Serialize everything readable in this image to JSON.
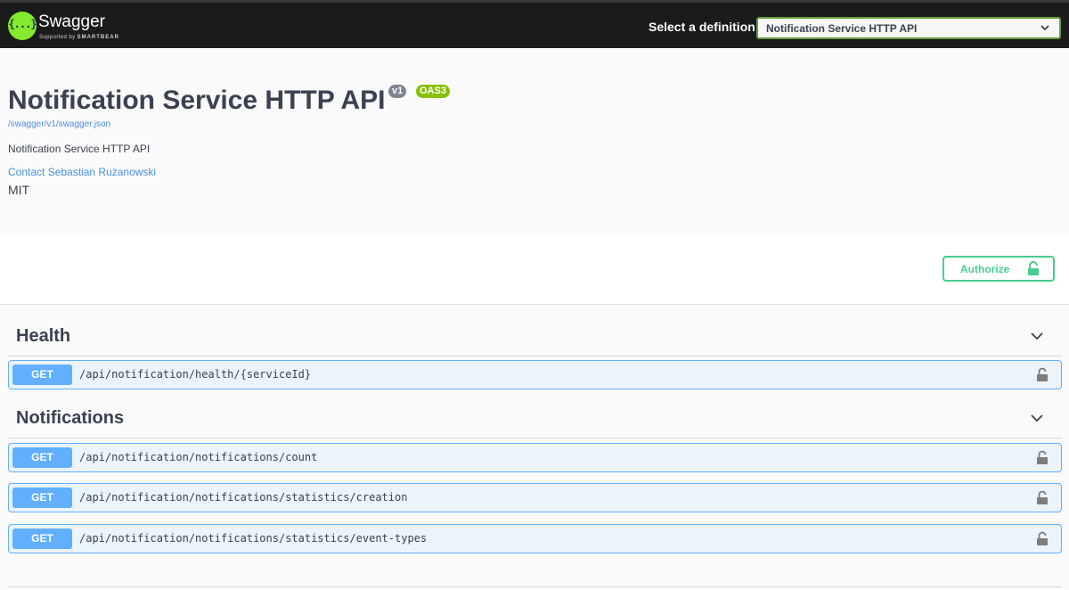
{
  "topbar": {
    "brand": "Swagger",
    "brand_sub_prefix": "Supported by",
    "brand_sub_name": "SMARTBEAR",
    "logo_glyph": "{...}",
    "definition_label": "Select a definition",
    "definition_selected": "Notification Service HTTP API"
  },
  "info": {
    "title": "Notification Service HTTP API",
    "version_badge": "v1",
    "oas_badge": "OAS3",
    "spec_url": "/swagger/v1/swagger.json",
    "description": "Notification Service HTTP API",
    "contact": "Contact Sebastian Rużanowski",
    "license": "MIT"
  },
  "authorize": {
    "label": "Authorize"
  },
  "tags": [
    {
      "name": "Health",
      "operations": [
        {
          "method": "GET",
          "path": "/api/notification/health/{serviceId}"
        }
      ]
    },
    {
      "name": "Notifications",
      "operations": [
        {
          "method": "GET",
          "path": "/api/notification/notifications/count"
        },
        {
          "method": "GET",
          "path": "/api/notification/notifications/statistics/creation"
        },
        {
          "method": "GET",
          "path": "/api/notification/notifications/statistics/event-types"
        }
      ]
    }
  ],
  "colors": {
    "get": "#61affe",
    "get_bg": "#ebf3fb",
    "authorize": "#49cc90",
    "logo": "#85ea2d",
    "oas_badge": "#89bf04",
    "version_badge": "#7d8492",
    "link": "#4990e2"
  }
}
